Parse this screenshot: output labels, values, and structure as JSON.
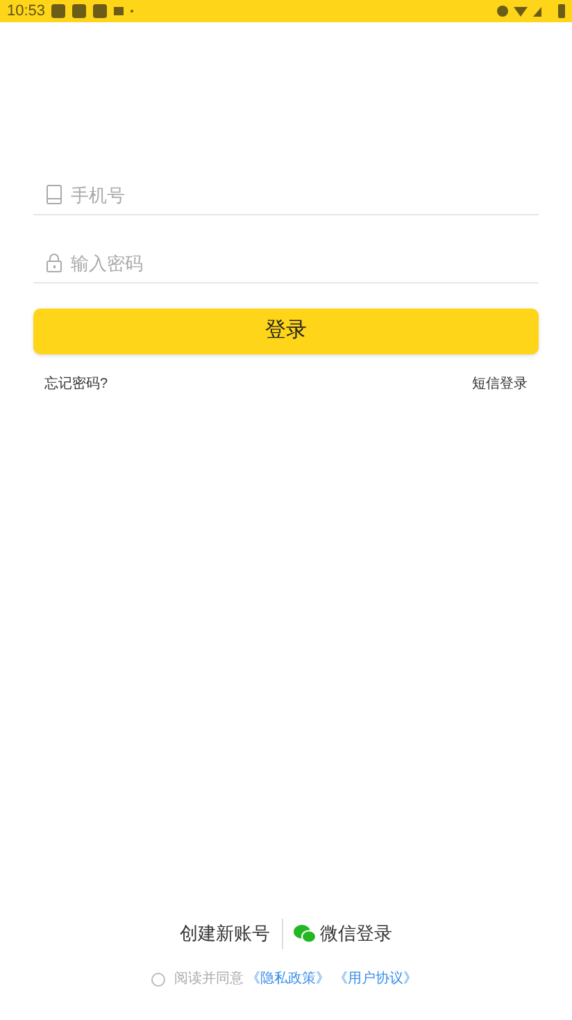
{
  "status_bar": {
    "time": "10:53"
  },
  "phone_field": {
    "placeholder": "手机号"
  },
  "password_field": {
    "placeholder": "输入密码"
  },
  "login_button": {
    "label": "登录"
  },
  "forgot_password": "忘记密码?",
  "sms_login": "短信登录",
  "create_account": "创建新账号",
  "wechat_login": "微信登录",
  "agreement": {
    "checked": false,
    "text": "阅读并同意",
    "links": [
      "《隐私政策》",
      "《用户协议》"
    ]
  }
}
